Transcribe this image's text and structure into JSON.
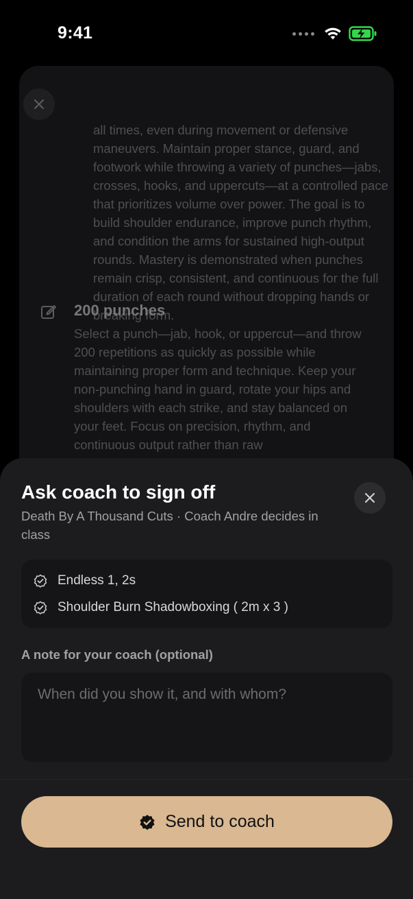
{
  "status_bar": {
    "time": "9:41",
    "icons": [
      "signal-dots-icon",
      "wifi-icon",
      "battery-charging-icon"
    ],
    "battery_color": "#32d74b"
  },
  "background_screen": {
    "close_icon": "close-icon",
    "description_1": "all times, even during movement or defensive maneuvers. Maintain proper stance, guard, and footwork while throwing a variety of punches—jabs, crosses, hooks, and uppercuts—at a controlled pace that prioritizes volume over power. The goal is to build shoulder endurance, improve punch rhythm, and condition the arms for sustained high-output rounds. Mastery is demonstrated when punches remain crisp, consistent, and continuous for the full duration of each round without dropping hands or breaking form.",
    "item_icon": "edit-icon",
    "item_title": "200 punches",
    "description_2": "Select a punch—jab, hook, or uppercut—and throw 200 repetitions as quickly as possible while maintaining proper form and technique. Keep your non-punching hand in guard, rotate your hips and shoulders with each strike, and stay balanced on your feet. Focus on precision, rhythm, and continuous output rather than raw"
  },
  "sheet": {
    "title": "Ask coach to sign off",
    "subtitle": "Death By A Thousand Cuts · Coach Andre decides in class",
    "close_icon": "close-icon",
    "skills": [
      {
        "icon": "verified-badge-icon",
        "label": "Endless 1, 2s"
      },
      {
        "icon": "verified-badge-icon",
        "label": "Shoulder Burn Shadowboxing ( 2m x 3 )"
      }
    ],
    "note_label": "A note for your coach (optional)",
    "note_placeholder": "When did you show it, and with whom?",
    "note_value": "",
    "send_button": {
      "icon": "verified-badge-icon",
      "label": "Send to coach"
    }
  },
  "colors": {
    "accent": "#d9b892",
    "sheet_bg": "#1c1c1e",
    "field_bg": "#151517",
    "secondary_text": "#a1a1a6"
  }
}
